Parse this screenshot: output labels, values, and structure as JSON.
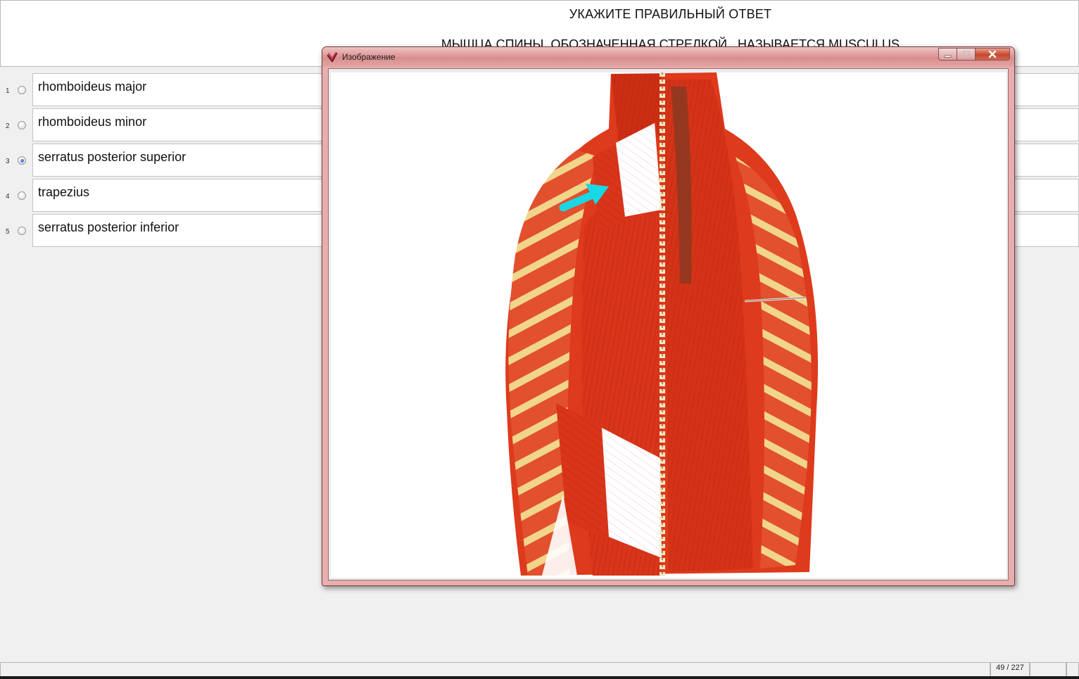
{
  "question": {
    "header": "УКАЖИТЕ ПРАВИЛЬНЫЙ ОТВЕТ",
    "text": "МЫШЦА СПИНЫ, ОБОЗНАЧЕННАЯ СТРЕЛКОЙ , НАЗЫВАЕТСЯ MUSCULUS"
  },
  "answers": [
    {
      "number": "1",
      "text": "rhomboideus major",
      "selected": false
    },
    {
      "number": "2",
      "text": "rhomboideus minor",
      "selected": false
    },
    {
      "number": "3",
      "text": "serratus posterior superior",
      "selected": true
    },
    {
      "number": "4",
      "text": "trapezius",
      "selected": false
    },
    {
      "number": "5",
      "text": "serratus posterior inferior",
      "selected": false
    }
  ],
  "image_window": {
    "title": "Изображение",
    "icons": {
      "app": "app-icon",
      "minimize": "minimize-icon",
      "maximize": "maximize-icon",
      "close": "close-icon"
    },
    "image": {
      "subject": "back-muscles-illustration",
      "arrow_color": "#19d8e6",
      "muscle_color": "#d9331a"
    }
  },
  "status": {
    "counter": "49 / 227"
  },
  "colors": {
    "window_frame": "#e6aeae",
    "close_button": "#c6472e",
    "radio_selected": "#1d4f9c"
  }
}
